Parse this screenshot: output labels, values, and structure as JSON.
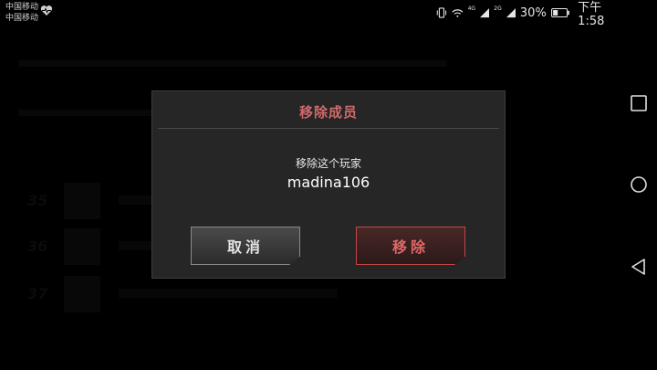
{
  "status_bar": {
    "carrier_1": "中国移动",
    "carrier_2": "中国移动",
    "net_4g": "4G",
    "net_2g": "2G",
    "battery": "30%",
    "time": "下午1:58"
  },
  "dialog": {
    "title": "移除成员",
    "message": "移除这个玩家",
    "player": "madina106",
    "cancel_label": "取消",
    "remove_label": "移除"
  },
  "colors": {
    "accent_red": "#d06a6a",
    "dialog_bg": "#262626"
  },
  "icons": [
    "heart-pulse-icon",
    "vibrate-icon",
    "wifi-icon",
    "signal-icon",
    "battery-icon",
    "recent-apps-icon",
    "home-icon",
    "back-icon"
  ]
}
